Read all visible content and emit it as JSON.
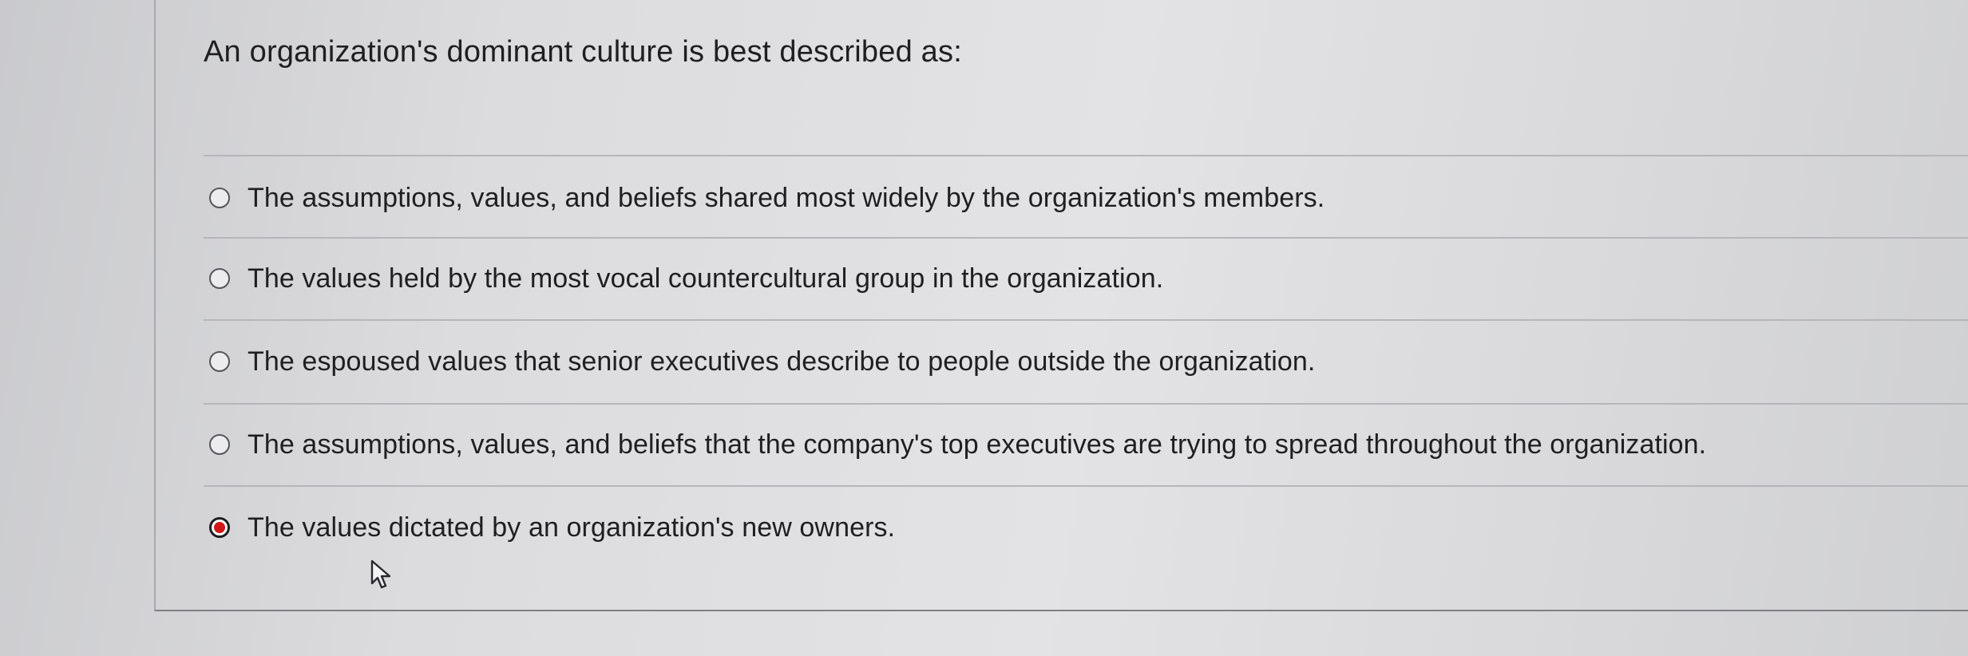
{
  "question": {
    "text": "An organization's dominant culture is best described as:"
  },
  "options": [
    {
      "label": "The assumptions, values, and beliefs shared most widely by the organization's members.",
      "selected": false
    },
    {
      "label": "The values held by the most vocal countercultural group in the organization.",
      "selected": false
    },
    {
      "label": "The espoused values that senior executives describe to people outside the organization.",
      "selected": false
    },
    {
      "label": "The assumptions, values, and beliefs that the company's top executives are trying to spread throughout the organization.",
      "selected": false
    },
    {
      "label": "The values dictated by an organization's new owners.",
      "selected": true
    }
  ],
  "colors": {
    "selected_dot": "#d01616",
    "text": "#1f1f22"
  }
}
